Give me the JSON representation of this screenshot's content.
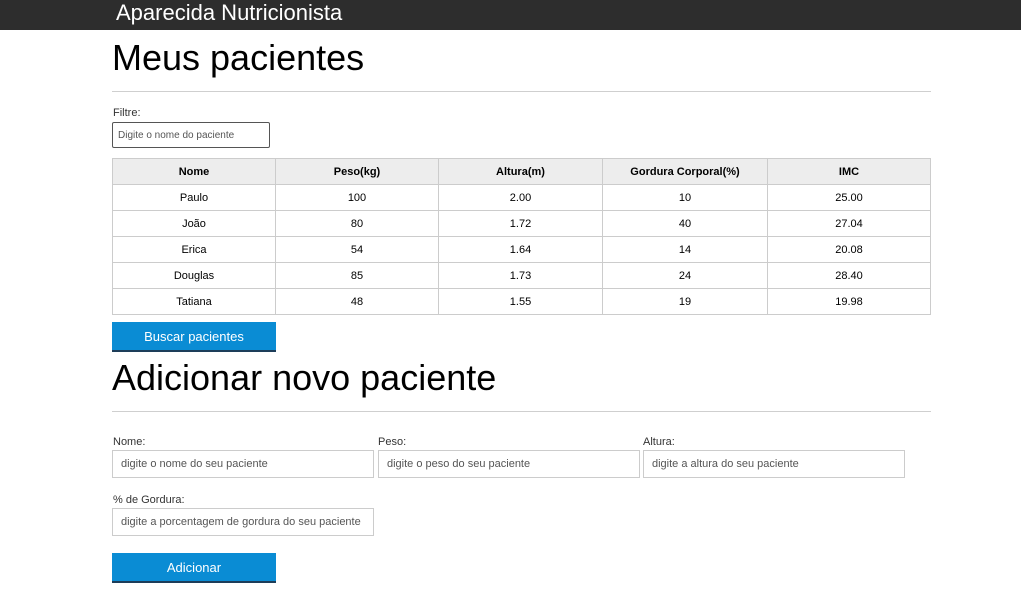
{
  "header": {
    "brand": "Aparecida Nutricionista"
  },
  "patients_section": {
    "title": "Meus pacientes",
    "filter_label": "Filtre:",
    "filter_placeholder": "Digite o nome do paciente",
    "columns": [
      "Nome",
      "Peso(kg)",
      "Altura(m)",
      "Gordura Corporal(%)",
      "IMC"
    ],
    "rows": [
      [
        "Paulo",
        "100",
        "2.00",
        "10",
        "25.00"
      ],
      [
        "João",
        "80",
        "1.72",
        "40",
        "27.04"
      ],
      [
        "Erica",
        "54",
        "1.64",
        "14",
        "20.08"
      ],
      [
        "Douglas",
        "85",
        "1.73",
        "24",
        "28.40"
      ],
      [
        "Tatiana",
        "48",
        "1.55",
        "19",
        "19.98"
      ]
    ],
    "search_button": "Buscar pacientes"
  },
  "add_section": {
    "title": "Adicionar novo paciente",
    "name_label": "Nome:",
    "name_placeholder": "digite o nome do seu paciente",
    "weight_label": "Peso:",
    "weight_placeholder": "digite o peso do seu paciente",
    "height_label": "Altura:",
    "height_placeholder": "digite a altura do seu paciente",
    "fat_label": "% de Gordura:",
    "fat_placeholder": "digite a porcentagem de gordura do seu paciente",
    "add_button": "Adicionar"
  },
  "colors": {
    "header_bg": "#2d2d2d",
    "button_bg": "#0a8cd4",
    "table_header_bg": "#ededed"
  }
}
